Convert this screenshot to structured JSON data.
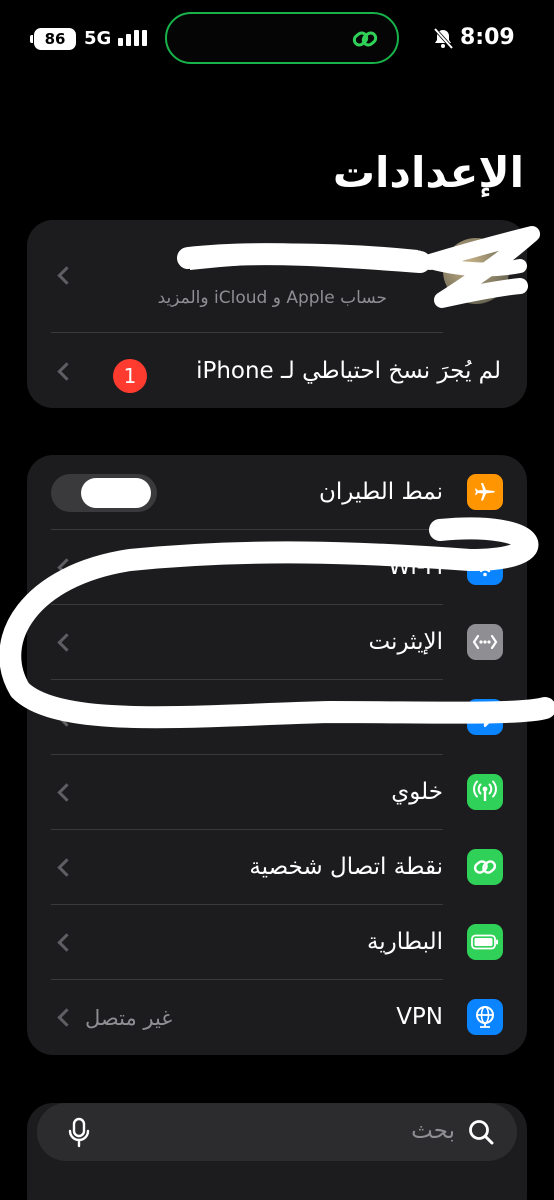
{
  "status_bar": {
    "battery": "86",
    "network": "5G",
    "time": "8:09"
  },
  "title": "الإعدادات",
  "account": {
    "name": "A",
    "subtitle": "حساب Apple و iCloud والمزيد"
  },
  "backup_row": {
    "label": "لم يُجرَ نسخ احتياطي لـ iPhone",
    "badge": "1"
  },
  "settings": [
    {
      "label": "نمط الطيران",
      "icon": "airplane-icon",
      "color": "#ff9500"
    },
    {
      "label": "Wi-Fi",
      "icon": "wifi-icon",
      "color": "#0a84ff"
    },
    {
      "label": "الإيثرنت",
      "icon": "ethernet-icon",
      "color": "#8e8e93"
    },
    {
      "label": "",
      "icon": "bluetooth-icon",
      "color": "#0a84ff"
    },
    {
      "label": "خلوي",
      "icon": "cellular-icon",
      "color": "#30d158"
    },
    {
      "label": "نقطة اتصال شخصية",
      "icon": "hotspot-icon",
      "color": "#30d158"
    },
    {
      "label": "البطارية",
      "icon": "battery-icon",
      "color": "#30d158"
    },
    {
      "label": "VPN",
      "icon": "vpn-globe-icon",
      "color": "#0a84ff",
      "value": "غير متصل"
    }
  ],
  "search": {
    "placeholder": "بحث"
  }
}
